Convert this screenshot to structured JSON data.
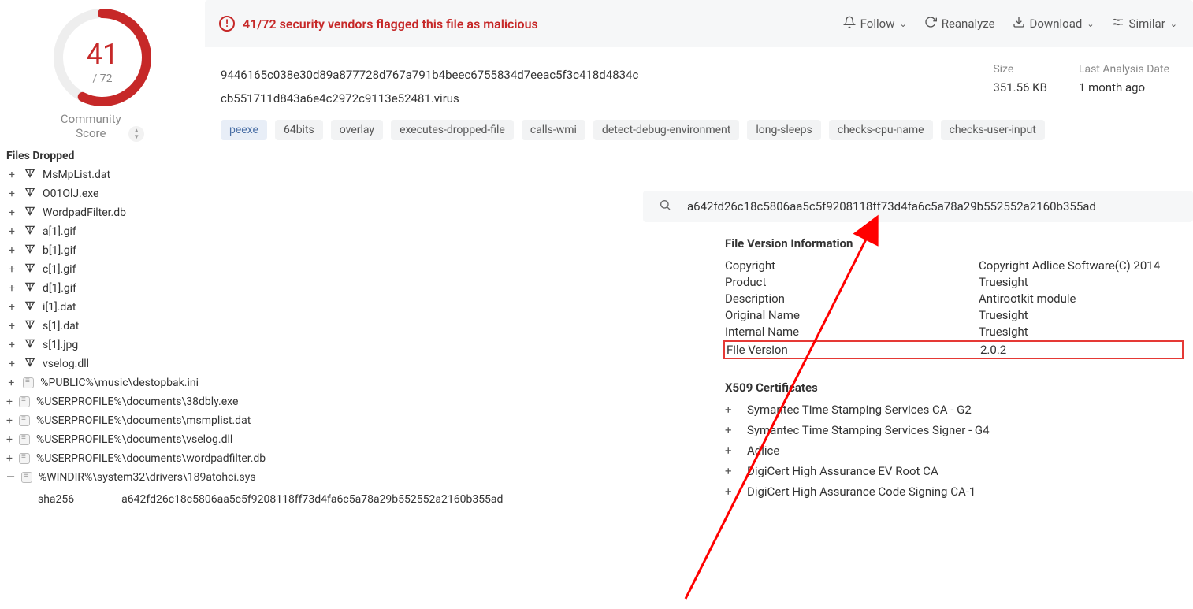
{
  "score": {
    "detections": "41",
    "total": "/ 72",
    "community_label": "Community\nScore"
  },
  "header": {
    "warn_text": "41/72 security vendors flagged this file as malicious",
    "actions": {
      "follow": "Follow",
      "reanalyze": "Reanalyze",
      "download": "Download",
      "similar": "Similar"
    }
  },
  "hash": {
    "sha256_full": "9446165c038e30d89a877728d767a791b4beec6755834d7eeac5f3c418d4834c",
    "filename": "cb551711d843a6e4c2972c9113e52481.virus"
  },
  "meta": {
    "size_label": "Size",
    "size_value": "351.56 KB",
    "date_label": "Last Analysis Date",
    "date_value": "1 month ago"
  },
  "tags": [
    "peexe",
    "64bits",
    "overlay",
    "executes-dropped-file",
    "calls-wmi",
    "detect-debug-environment",
    "long-sleeps",
    "checks-cpu-name",
    "checks-user-input"
  ],
  "files_dropped_heading": "Files Dropped",
  "files_dropped": [
    {
      "expand": "+",
      "icon": "vt",
      "name": "MsMpList.dat"
    },
    {
      "expand": "+",
      "icon": "vt",
      "name": "O01OlJ.exe"
    },
    {
      "expand": "+",
      "icon": "vt",
      "name": "WordpadFilter.db"
    },
    {
      "expand": "+",
      "icon": "vt",
      "name": "a[1].gif"
    },
    {
      "expand": "+",
      "icon": "vt",
      "name": "b[1].gif"
    },
    {
      "expand": "+",
      "icon": "vt",
      "name": "c[1].gif"
    },
    {
      "expand": "+",
      "icon": "vt",
      "name": "d[1].gif"
    },
    {
      "expand": "+",
      "icon": "vt",
      "name": "i[1].dat"
    },
    {
      "expand": "+",
      "icon": "vt",
      "name": "s[1].dat"
    },
    {
      "expand": "+",
      "icon": "vt",
      "name": "s[1].jpg"
    },
    {
      "expand": "+",
      "icon": "vt",
      "name": "vselog.dll"
    },
    {
      "expand": "+",
      "icon": "zip",
      "name": "%PUBLIC%\\music\\destopbak.ini"
    },
    {
      "expand": "+",
      "icon": "zip",
      "name": "%USERPROFILE%\\documents\\38dbly.exe"
    },
    {
      "expand": "+",
      "icon": "zip",
      "name": "%USERPROFILE%\\documents\\msmplist.dat"
    },
    {
      "expand": "+",
      "icon": "zip",
      "name": "%USERPROFILE%\\documents\\vselog.dll"
    },
    {
      "expand": "+",
      "icon": "zip",
      "name": "%USERPROFILE%\\documents\\wordpadfilter.db"
    },
    {
      "expand": "—",
      "icon": "zip",
      "name": "%WINDIR%\\system32\\drivers\\189atohci.sys"
    }
  ],
  "sha_row": {
    "label": "sha256",
    "value": "a642fd26c18c5806aa5c5f9208118ff73d4fa6c5a78a29b552552a2160b355ad"
  },
  "search": {
    "value": "a642fd26c18c5806aa5c5f9208118ff73d4fa6c5a78a29b552552a2160b355ad"
  },
  "fvi": {
    "heading": "File Version Information",
    "rows": [
      {
        "k": "Copyright",
        "v": "Copyright Adlice Software(C) 2014"
      },
      {
        "k": "Product",
        "v": "Truesight"
      },
      {
        "k": "Description",
        "v": "Antirootkit module"
      },
      {
        "k": "Original Name",
        "v": "Truesight"
      },
      {
        "k": "Internal Name",
        "v": "Truesight"
      },
      {
        "k": "File Version",
        "v": "2.0.2"
      }
    ]
  },
  "certs": {
    "heading": "X509 Certificates",
    "items": [
      "Symantec Time Stamping Services CA - G2",
      "Symantec Time Stamping Services Signer - G4",
      "Adlice",
      "DigiCert High Assurance EV Root CA",
      "DigiCert High Assurance Code Signing CA-1"
    ]
  }
}
